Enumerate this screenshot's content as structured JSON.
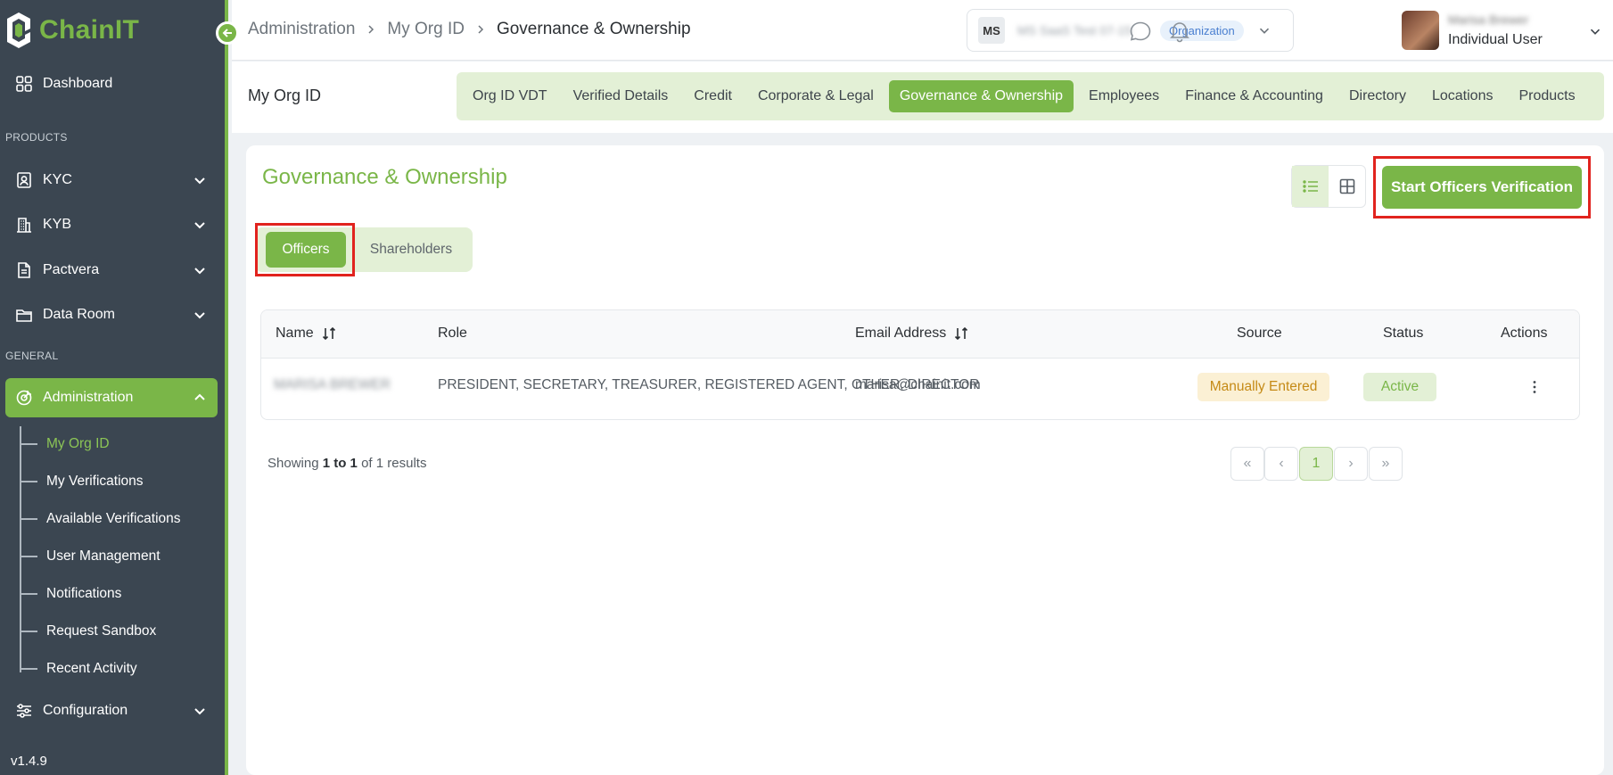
{
  "brand": {
    "name": "ChainIT",
    "accent": "#7ab648",
    "highlight": "#e1231e"
  },
  "sidebar": {
    "dashboard": "Dashboard",
    "products_label": "PRODUCTS",
    "products": [
      {
        "label": "KYC",
        "icon": "id-card-icon"
      },
      {
        "label": "KYB",
        "icon": "building-icon"
      },
      {
        "label": "Pactvera",
        "icon": "document-icon"
      },
      {
        "label": "Data Room",
        "icon": "folder-icon"
      }
    ],
    "general_label": "GENERAL",
    "administration": "Administration",
    "admin_items": [
      "My Org ID",
      "My Verifications",
      "Available Verifications",
      "User Management",
      "Notifications",
      "Request Sandbox",
      "Recent Activity"
    ],
    "configuration": "Configuration",
    "version": "v1.4.9"
  },
  "header": {
    "breadcrumb": [
      "Administration",
      "My Org ID",
      "Governance & Ownership"
    ],
    "org": {
      "initials": "MS",
      "name": "MS SaaS Test 07-15",
      "tag": "Organization"
    },
    "user": {
      "name": "Marisa Brewer",
      "role": "Individual User"
    }
  },
  "subheader": {
    "title": "My Org ID",
    "tabs": [
      "Org ID VDT",
      "Verified Details",
      "Credit",
      "Corporate & Legal",
      "Governance & Ownership",
      "Employees",
      "Finance & Accounting",
      "Directory",
      "Locations",
      "Products"
    ],
    "active_tab": "Governance & Ownership"
  },
  "main": {
    "title": "Governance & Ownership",
    "primary_action": "Start Officers Verification",
    "subtabs": [
      "Officers",
      "Shareholders"
    ],
    "table": {
      "columns": [
        "Name",
        "Role",
        "Email Address",
        "Source",
        "Status",
        "Actions"
      ],
      "rows": [
        {
          "name": "MARISA BREWER",
          "role": "PRESIDENT, SECRETARY, TREASURER, REGISTERED AGENT, OTHER, DIRECTOR",
          "email": "marisa@chainit.com",
          "source": "Manually Entered",
          "status": "Active"
        }
      ]
    },
    "pagination": {
      "prefix": "Showing",
      "range": "1 to 1",
      "of": "of",
      "total": "1",
      "suffix": "results",
      "current_page": "1",
      "first": "«",
      "prev": "‹",
      "next": "›",
      "last": "»"
    }
  }
}
